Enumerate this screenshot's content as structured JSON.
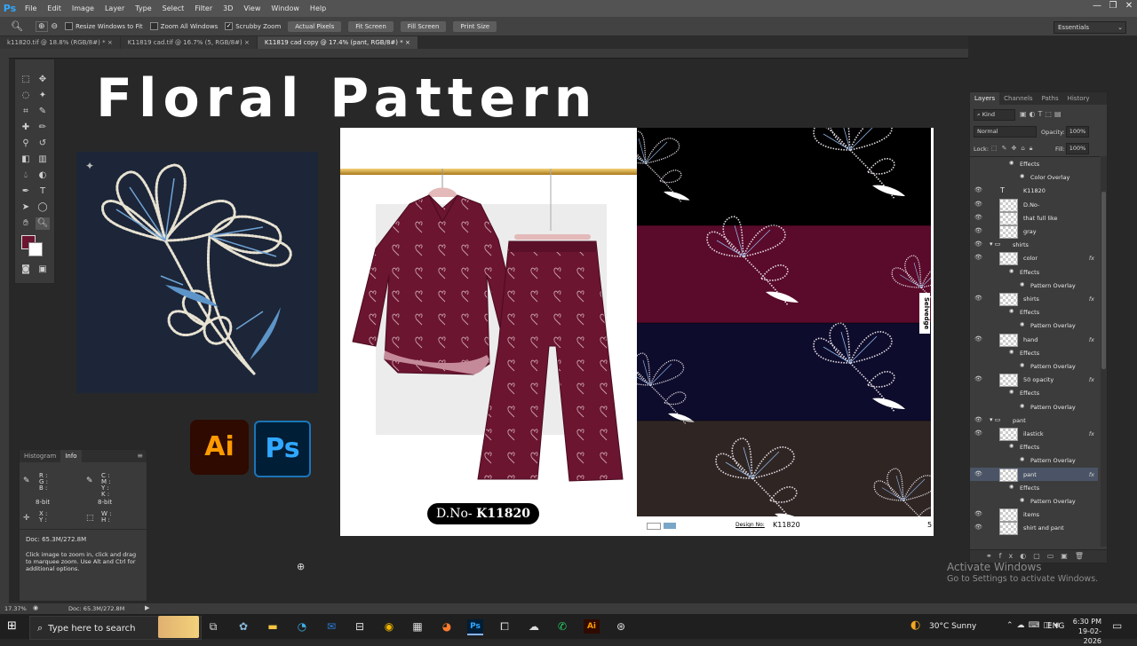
{
  "app": {
    "logo": "Ps",
    "window_controls": [
      "—",
      "❐",
      "✕"
    ]
  },
  "menu": [
    "File",
    "Edit",
    "Image",
    "Layer",
    "Type",
    "Select",
    "Filter",
    "3D",
    "View",
    "Window",
    "Help"
  ],
  "options": {
    "resize_windows": "Resize Windows to Fit",
    "zoom_all": "Zoom All Windows",
    "scrubby_zoom": "Scrubby Zoom",
    "buttons": [
      "Actual Pixels",
      "Fit Screen",
      "Fill Screen",
      "Print Size"
    ],
    "workspace": "Essentials"
  },
  "doc_tabs": [
    {
      "label": "k11820.tif @ 18.8% (RGB/8#) *",
      "close": "×"
    },
    {
      "label": "K11819 cad.tif @ 16.7% (5, RGB/8#)",
      "close": "×"
    },
    {
      "label": "K11819 cad copy @ 17.4% (pant, RGB/8#) *",
      "close": "×"
    }
  ],
  "canvas": {
    "headline": "Floral Pattern",
    "ai_logo": "Ai",
    "ps_logo": "Ps",
    "dno_prefix": "D.No-",
    "dno_value": "K11820",
    "selvedge": "Selvedge",
    "design_no_label": "Design No:",
    "design_no_value": "K11820",
    "page_num": "5",
    "colors": {
      "garment": "#6b1530",
      "bands": [
        "#000000",
        "#5a0a2a",
        "#0e0c2c",
        "#2f2624"
      ],
      "flower_panel": "#1c2638"
    }
  },
  "info_panel": {
    "tabs": [
      "Histogram",
      "Info"
    ],
    "rgb": [
      "R :",
      "G :",
      "B :"
    ],
    "cmyk": [
      "C :",
      "M :",
      "Y :",
      "K :"
    ],
    "bit_left": "8-bit",
    "bit_right": "8-bit",
    "xy": [
      "X :",
      "Y :"
    ],
    "wh": [
      "W :",
      "H :"
    ],
    "doc": "Doc: 65.3M/272.8M",
    "help": "Click image to zoom in, click and drag to marquee zoom.  Use Alt and Ctrl for additional options."
  },
  "layers_panel": {
    "tabs": [
      "Layers",
      "Channels",
      "Paths",
      "History"
    ],
    "kind": "Kind",
    "blend": "Normal",
    "opacity_label": "Opacity:",
    "opacity": "100%",
    "lock_label": "Lock:",
    "fill_label": "Fill:",
    "fill": "100%",
    "rows": [
      {
        "type": "effect",
        "label": "Effects"
      },
      {
        "type": "sub",
        "label": "Color Overlay"
      },
      {
        "type": "text",
        "label": "K11820"
      },
      {
        "type": "layer",
        "label": "D.No-"
      },
      {
        "type": "layer",
        "label": "that full like"
      },
      {
        "type": "layer",
        "label": "gray"
      },
      {
        "type": "group",
        "label": "shirts"
      },
      {
        "type": "layer",
        "label": "color",
        "fx": "fx"
      },
      {
        "type": "effect",
        "label": "Effects"
      },
      {
        "type": "sub",
        "label": "Pattern Overlay"
      },
      {
        "type": "layer",
        "label": "shirts",
        "fx": "fx"
      },
      {
        "type": "effect",
        "label": "Effects"
      },
      {
        "type": "sub",
        "label": "Pattern Overlay"
      },
      {
        "type": "layer",
        "label": "hand",
        "fx": "fx"
      },
      {
        "type": "effect",
        "label": "Effects"
      },
      {
        "type": "sub",
        "label": "Pattern Overlay"
      },
      {
        "type": "layer",
        "label": "50 opacity",
        "fx": "fx"
      },
      {
        "type": "effect",
        "label": "Effects"
      },
      {
        "type": "sub",
        "label": "Pattern Overlay"
      },
      {
        "type": "group",
        "label": "pant"
      },
      {
        "type": "layer",
        "label": "ilastick",
        "fx": "fx"
      },
      {
        "type": "effect",
        "label": "Effects"
      },
      {
        "type": "sub",
        "label": "Pattern Overlay"
      },
      {
        "type": "layer",
        "label": "pant",
        "fx": "fx",
        "selected": true
      },
      {
        "type": "effect",
        "label": "Effects"
      },
      {
        "type": "sub",
        "label": "Pattern Overlay"
      },
      {
        "type": "layer",
        "label": "items"
      },
      {
        "type": "layer",
        "label": "shirt and pant"
      }
    ]
  },
  "status": {
    "zoom": "17.37%",
    "doc": "Doc: 65.3M/272.8M"
  },
  "activation": {
    "title": "Activate Windows",
    "subtitle": "Go to Settings to activate Windows."
  },
  "taskbar": {
    "search_placeholder": "Type here to search",
    "weather": "30°C  Sunny",
    "lang": "ENG",
    "time": "6:30 PM",
    "date": "19-02-2026"
  }
}
